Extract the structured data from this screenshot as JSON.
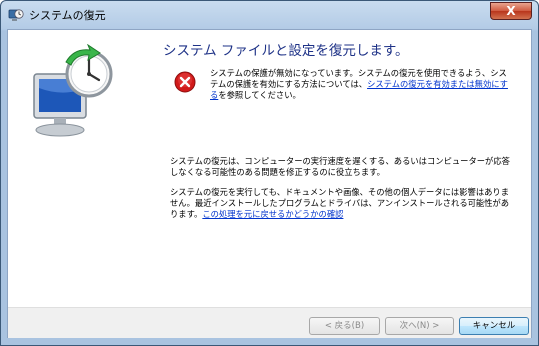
{
  "window": {
    "title": "システムの復元",
    "close_label": "X"
  },
  "main": {
    "heading": "システム ファイルと設定を復元します。",
    "error": {
      "text_before": "システムの保護が無効になっています。システムの復元を使用できるよう、システムの保護を有効にする方法については、",
      "link": "システムの復元を有効または無効にする",
      "text_after": "を参照してください。"
    },
    "info1": "システムの復元は、コンピューターの実行速度を遅くする、あるいはコンピューターが応答しなくなる可能性のある問題を修正するのに役立ちます。",
    "info2": {
      "text": "システムの復元を実行しても、ドキュメントや画像、その他の個人データには影響はありません。最近インストールしたプログラムとドライバは、アンインストールされる可能性があります。",
      "link": "この処理を元に戻せるかどうかの確認"
    }
  },
  "buttons": {
    "back": "< 戻る(B)",
    "next": "次へ(N) >",
    "cancel": "キャンセル"
  },
  "colors": {
    "heading": "#1e3287",
    "link": "#0033cc",
    "error_icon": "#d11a1a"
  },
  "icons": {
    "title": "system-restore-icon",
    "art": "system-restore-art",
    "error": "error-icon"
  }
}
